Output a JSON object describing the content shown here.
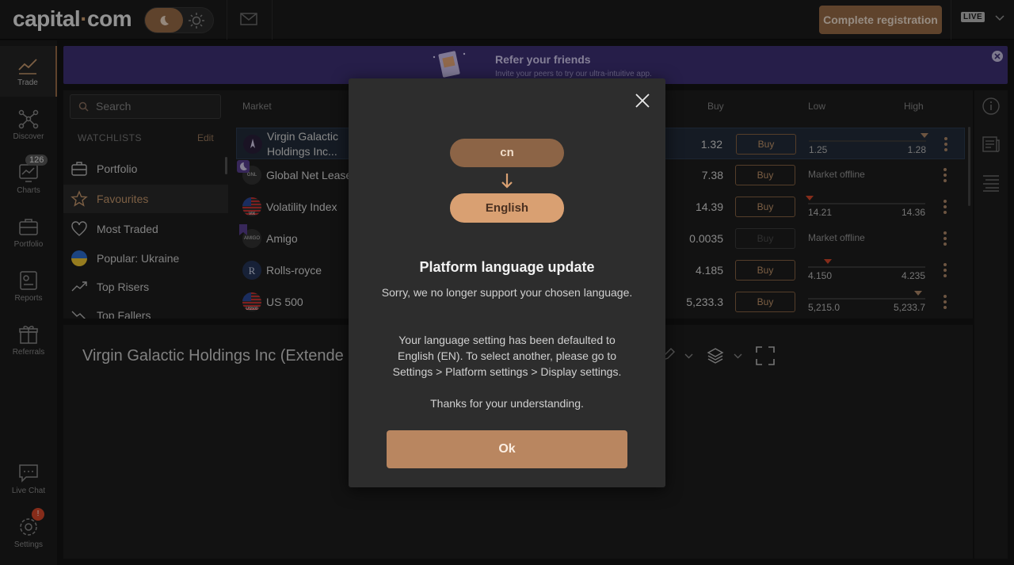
{
  "header": {
    "logo_text_a": "capital",
    "logo_dot": "·",
    "logo_text_b": "com",
    "complete_registration": "Complete registration",
    "account_mode": "LIVE"
  },
  "leftnav": [
    {
      "label": "Trade",
      "icon": "trade-icon"
    },
    {
      "label": "Discover",
      "icon": "discover-icon"
    },
    {
      "label": "Charts",
      "icon": "charts-icon",
      "badge": "126"
    },
    {
      "label": "Portfolio",
      "icon": "portfolio-icon"
    },
    {
      "label": "Reports",
      "icon": "reports-icon"
    },
    {
      "label": "Referrals",
      "icon": "gift-icon"
    },
    {
      "label": "Live Chat",
      "icon": "chat-icon"
    },
    {
      "label": "Settings",
      "icon": "settings-icon",
      "badge": "!"
    }
  ],
  "banner": {
    "title": "Refer your friends",
    "subtitle": "Invite your peers to try our ultra-intuitive app."
  },
  "search": {
    "placeholder": "Search"
  },
  "watchlists": {
    "heading": "WATCHLISTS",
    "edit": "Edit",
    "items": [
      "Portfolio",
      "Favourites",
      "Most Traded",
      "Popular: Ukraine",
      "Top Risers",
      "Top Fallers"
    ]
  },
  "table": {
    "headers": {
      "market": "Market",
      "buy": "Buy",
      "low": "Low",
      "high": "High"
    },
    "buy_label": "Buy",
    "offline_label": "Market offline",
    "rows": [
      {
        "name": "Virgin Galactic Holdings Inc...",
        "flag": "",
        "price": "1.32",
        "low": "1.25",
        "high": "1.28"
      },
      {
        "name": "Global Net Lease",
        "flag": "GNL",
        "price": "7.38"
      },
      {
        "name": "Volatility Index",
        "flag": "VIX",
        "price": "14.39",
        "low": "14.21",
        "high": "14.36"
      },
      {
        "name": "Amigo",
        "flag": "AMIGO",
        "price": "0.0035"
      },
      {
        "name": "Rolls-royce",
        "flag": "",
        "price": "4.185",
        "low": "4.150",
        "high": "4.235"
      },
      {
        "name": "US 500",
        "flag": "US500",
        "price": "5,233.3",
        "low": "5,215.0",
        "high": "5,233.7"
      }
    ]
  },
  "chart": {
    "title": "Virgin Galactic Holdings Inc (Extende"
  },
  "modal": {
    "from_lang": "cn",
    "to_lang": "English",
    "title": "Platform language update",
    "body1": "Sorry, we no longer support your chosen language.",
    "body2": "Your language setting has been defaulted to English (EN). To select another, please go to Settings > Platform settings > Display settings.",
    "body3": "Thanks for your understanding.",
    "ok": "Ok"
  },
  "colors": {
    "accent": "#9a6c48",
    "banner": "#3e3176",
    "negative": "#d9482b"
  }
}
